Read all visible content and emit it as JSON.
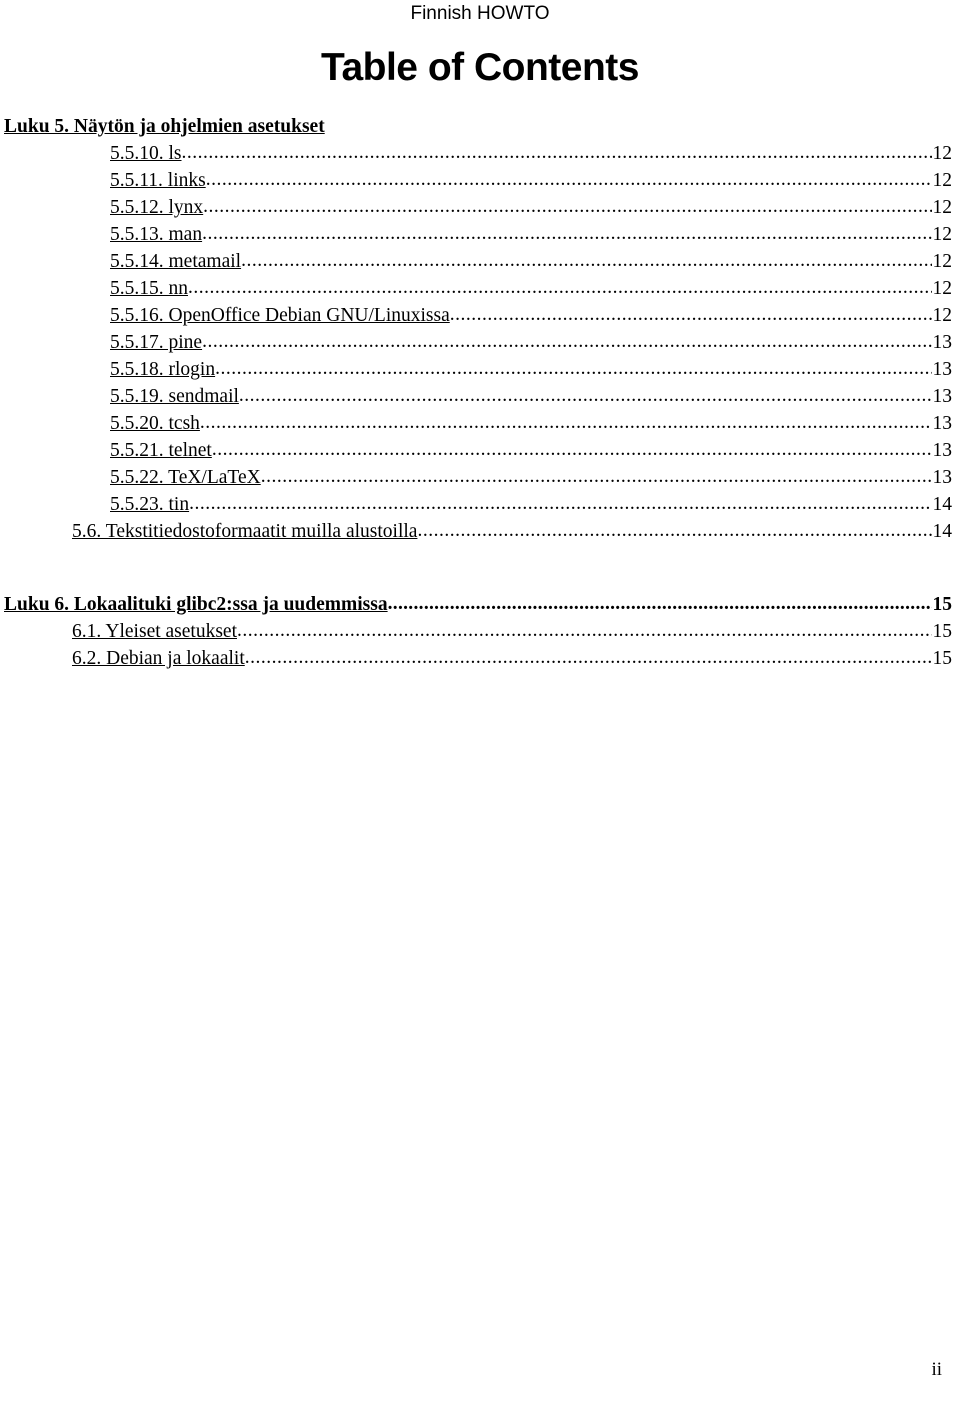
{
  "header": {
    "running_head": "Finnish HOWTO"
  },
  "title": "Table of Contents",
  "toc": {
    "entries": [
      {
        "label": "Luku 5. Näytön ja ohjelmien asetukset",
        "page": "",
        "level": 1,
        "bold": true,
        "leaders": false,
        "gap_before": false
      },
      {
        "label": "5.5.10. ls",
        "page": "12",
        "level": 3,
        "bold": false,
        "leaders": true,
        "gap_before": false
      },
      {
        "label": "5.5.11. links",
        "page": "12",
        "level": 3,
        "bold": false,
        "leaders": true,
        "gap_before": false
      },
      {
        "label": "5.5.12. lynx",
        "page": "12",
        "level": 3,
        "bold": false,
        "leaders": true,
        "gap_before": false
      },
      {
        "label": "5.5.13. man",
        "page": "12",
        "level": 3,
        "bold": false,
        "leaders": true,
        "gap_before": false
      },
      {
        "label": "5.5.14. metamail",
        "page": "12",
        "level": 3,
        "bold": false,
        "leaders": true,
        "gap_before": false
      },
      {
        "label": "5.5.15. nn",
        "page": "12",
        "level": 3,
        "bold": false,
        "leaders": true,
        "gap_before": false
      },
      {
        "label": "5.5.16. OpenOffice Debian GNU/Linuxissa",
        "page": "12",
        "level": 3,
        "bold": false,
        "leaders": true,
        "gap_before": false
      },
      {
        "label": "5.5.17. pine",
        "page": "13",
        "level": 3,
        "bold": false,
        "leaders": true,
        "gap_before": false
      },
      {
        "label": "5.5.18. rlogin",
        "page": "13",
        "level": 3,
        "bold": false,
        "leaders": true,
        "gap_before": false
      },
      {
        "label": "5.5.19. sendmail",
        "page": "13",
        "level": 3,
        "bold": false,
        "leaders": true,
        "gap_before": false
      },
      {
        "label": "5.5.20. tcsh",
        "page": "13",
        "level": 3,
        "bold": false,
        "leaders": true,
        "gap_before": false
      },
      {
        "label": "5.5.21. telnet",
        "page": "13",
        "level": 3,
        "bold": false,
        "leaders": true,
        "gap_before": false
      },
      {
        "label": "5.5.22. TeX/LaTeX",
        "page": "13",
        "level": 3,
        "bold": false,
        "leaders": true,
        "gap_before": false
      },
      {
        "label": "5.5.23. tin",
        "page": "14",
        "level": 3,
        "bold": false,
        "leaders": true,
        "gap_before": false
      },
      {
        "label": "5.6. Tekstitiedostoformaatit muilla alustoilla",
        "page": "14",
        "level": 2,
        "bold": false,
        "leaders": true,
        "gap_before": false
      },
      {
        "label": "Luku 6. Lokaalituki glibc2:ssa ja uudemmissa",
        "page": "15",
        "level": 1,
        "bold": true,
        "leaders": true,
        "gap_before": true
      },
      {
        "label": "6.1. Yleiset asetukset",
        "page": "15",
        "level": 2,
        "bold": false,
        "leaders": true,
        "gap_before": false
      },
      {
        "label": "6.2. Debian ja lokaalit",
        "page": "15",
        "level": 2,
        "bold": false,
        "leaders": true,
        "gap_before": false
      }
    ]
  },
  "footer": {
    "folio": "ii"
  }
}
